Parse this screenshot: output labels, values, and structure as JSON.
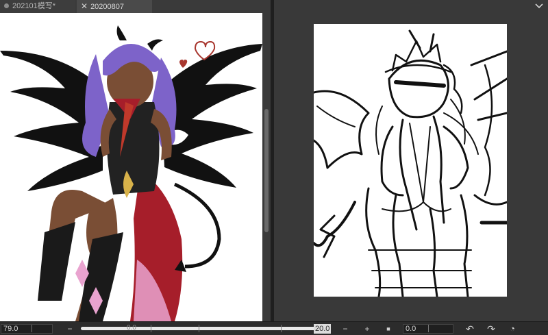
{
  "tabs": [
    {
      "label": "202101模写*",
      "active": false
    },
    {
      "label": "20200807",
      "active": true
    }
  ],
  "icons": {
    "tab_modified": "dot-icon",
    "tab_close": "close-icon",
    "tab_menu": "chevron-down-icon",
    "zoom_out": "minus-icon",
    "zoom_in": "plus-icon",
    "fit": "square-icon",
    "rotate_left": "rotate-left-icon",
    "rotate_right": "rotate-right-icon",
    "reset": "reset-icon"
  },
  "bottom_bar": {
    "zoom_value": "79.0",
    "left_slider_mid": "0.0",
    "right_slider_value": "20.0",
    "angle_value": "0.0",
    "minus_symbol": "−",
    "plus_symbol": "+",
    "fit_symbol": "■",
    "rotate_left_symbol": "↶",
    "rotate_right_symbol": "↷",
    "reset_symbol": "◔"
  },
  "colors": {
    "hair": "#7d63c9",
    "skin": "#7a4e35",
    "wings": "#111111",
    "cape": "#a61e2a",
    "cape_fade": "#e9a3cf",
    "accent_gold": "#d8b24a",
    "heart": "#a8372f"
  }
}
